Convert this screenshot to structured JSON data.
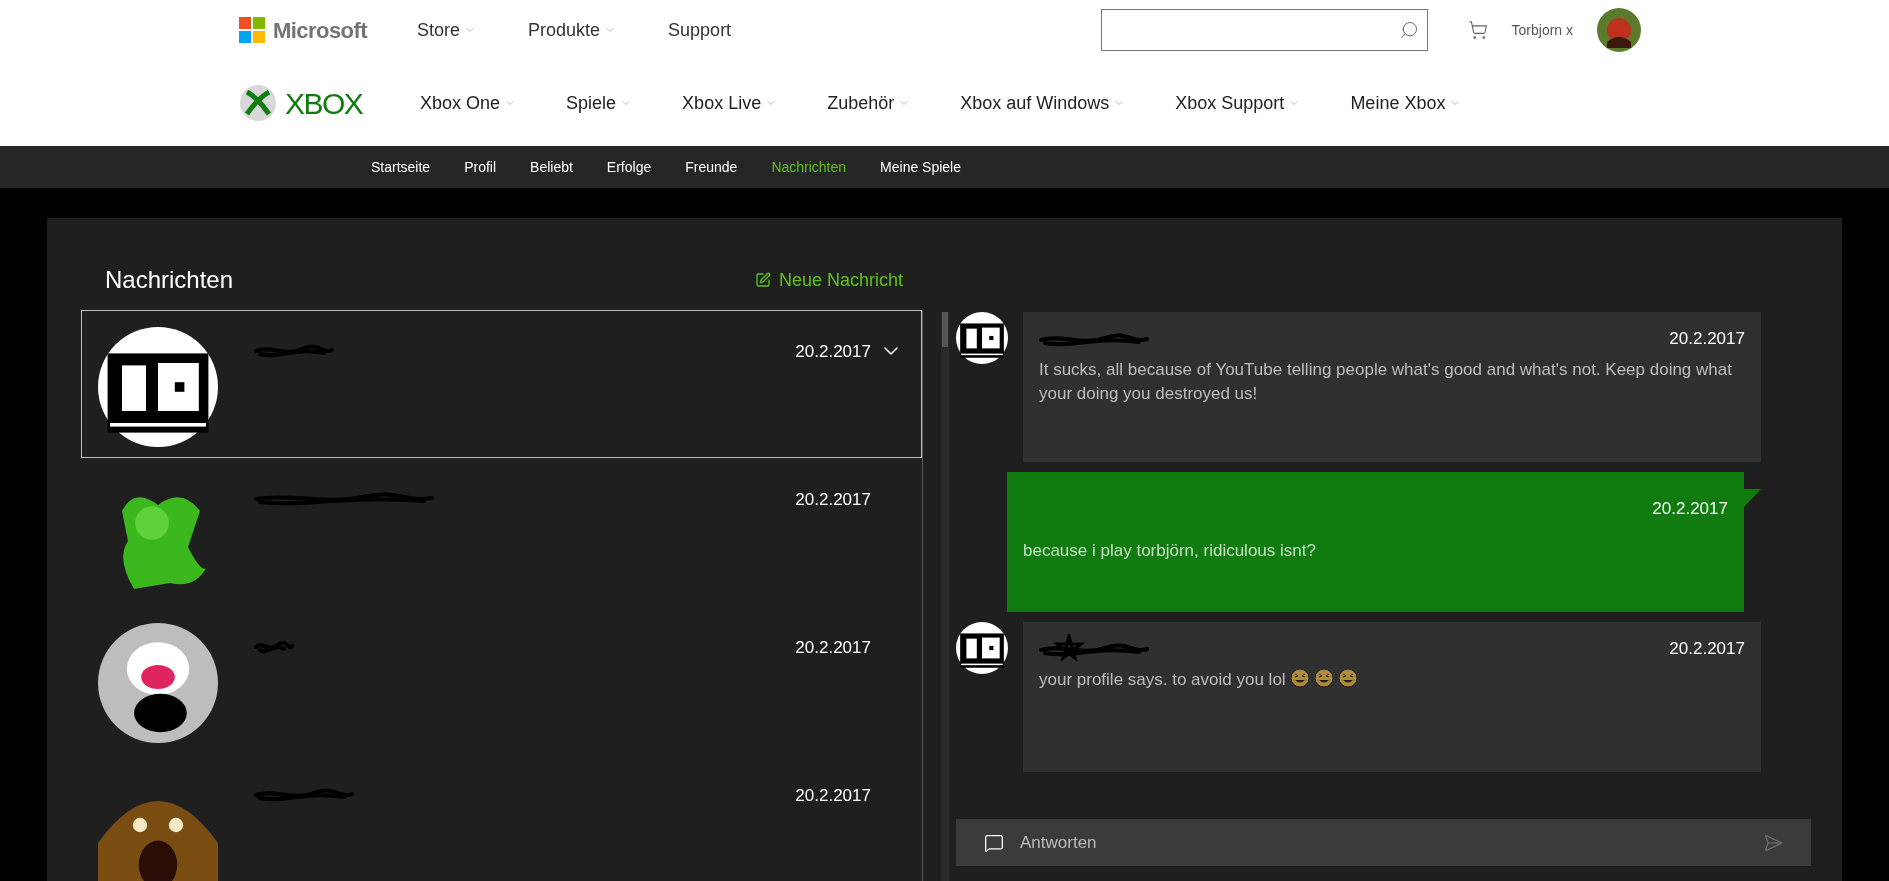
{
  "header": {
    "brand": "Microsoft",
    "nav": [
      {
        "label": "Store",
        "dropdown": true
      },
      {
        "label": "Produkte",
        "dropdown": true
      },
      {
        "label": "Support",
        "dropdown": false
      }
    ],
    "user": "Torbjorn x"
  },
  "xbox_nav": {
    "brand": "XBOX",
    "items": [
      {
        "label": "Xbox One",
        "dropdown": true
      },
      {
        "label": "Spiele",
        "dropdown": true
      },
      {
        "label": "Xbox Live",
        "dropdown": true
      },
      {
        "label": "Zubehör",
        "dropdown": true
      },
      {
        "label": "Xbox auf Windows",
        "dropdown": true
      },
      {
        "label": "Xbox Support",
        "dropdown": true
      },
      {
        "label": "Meine Xbox",
        "dropdown": true
      }
    ]
  },
  "subnav": [
    {
      "label": "Startseite",
      "selected": false
    },
    {
      "label": "Profil",
      "selected": false
    },
    {
      "label": "Beliebt",
      "selected": false
    },
    {
      "label": "Erfolge",
      "selected": false
    },
    {
      "label": "Freunde",
      "selected": false
    },
    {
      "label": "Nachrichten",
      "selected": true
    },
    {
      "label": "Meine Spiele",
      "selected": false
    }
  ],
  "conversations": {
    "title": "Nachrichten",
    "new_message": "Neue Nachricht",
    "items": [
      {
        "date": "20.2.2017",
        "selected": true
      },
      {
        "date": "20.2.2017",
        "selected": false
      },
      {
        "date": "20.2.2017",
        "selected": false
      },
      {
        "date": "20.2.2017",
        "selected": false
      }
    ]
  },
  "thread": {
    "messages": [
      {
        "kind": "received",
        "date": "20.2.2017",
        "text": "It sucks, all because of YouTube telling people what's good and what's not. Keep doing what your doing you destroyed us!"
      },
      {
        "kind": "sent",
        "date": "20.2.2017",
        "text": "because i play torbjörn, ridiculous isnt?"
      },
      {
        "kind": "received",
        "date": "20.2.2017",
        "text": "your profile says. to avoid you lol",
        "trailing_icons": [
          {
            "kind": "emoji"
          },
          {
            "kind": "emoji"
          },
          {
            "kind": "emoji"
          }
        ]
      }
    ],
    "reply": {
      "placeholder": "Antworten"
    }
  }
}
